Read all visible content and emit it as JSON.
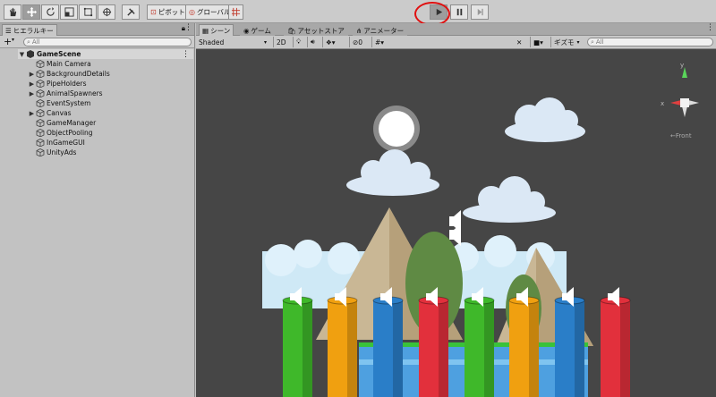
{
  "toolbar": {
    "pivot_label": "ピボット",
    "global_label": "グローバル"
  },
  "hierarchy": {
    "tab_label": "ヒエラルキー",
    "search_placeholder": "All",
    "scene_name": "GameScene",
    "items": [
      {
        "label": "Main Camera",
        "expandable": false
      },
      {
        "label": "BackgroundDetails",
        "expandable": true
      },
      {
        "label": "PipeHolders",
        "expandable": true
      },
      {
        "label": "AnimalSpawners",
        "expandable": true
      },
      {
        "label": "EventSystem",
        "expandable": false
      },
      {
        "label": "Canvas",
        "expandable": true
      },
      {
        "label": "GameManager",
        "expandable": false
      },
      {
        "label": "ObjectPooling",
        "expandable": false
      },
      {
        "label": "InGameGUI",
        "expandable": false
      },
      {
        "label": "UnityAds",
        "expandable": false
      }
    ]
  },
  "scene_view": {
    "tabs": [
      "シーン",
      "ゲーム",
      "アセットストア",
      "アニメーター"
    ],
    "shading_mode": "Shaded",
    "mode_2d": "2D",
    "hidden_count": "0",
    "gizmos_label": "ギズモ",
    "search_placeholder": "All",
    "gizmo_axis_x": "x",
    "gizmo_axis_y": "y",
    "gizmo_view_label": "←Front"
  },
  "pipe_colors": [
    "#3fb82a",
    "#f0a010",
    "#2a7ec8",
    "#e2303c",
    "#3fb82a",
    "#f0a010",
    "#2a7ec8",
    "#e2303c"
  ]
}
